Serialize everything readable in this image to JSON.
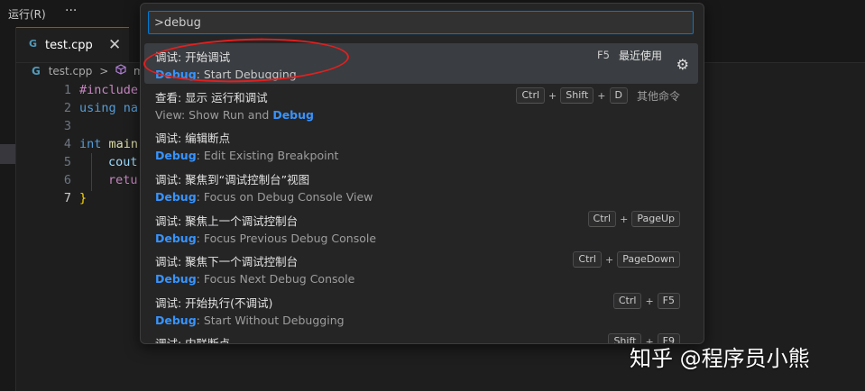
{
  "menubar": {
    "run_menu": "运行(R)",
    "more": "···"
  },
  "tab": {
    "label": "test.cpp",
    "icon": "C++",
    "close": "✕"
  },
  "breadcrumb": {
    "file": "test.cpp",
    "separator": ">",
    "symbol": "ma"
  },
  "editor": {
    "lines": [
      {
        "num": "1",
        "text": "#include"
      },
      {
        "num": "2",
        "text": "using na"
      },
      {
        "num": "3",
        "text": ""
      },
      {
        "num": "4",
        "text_kw": "int",
        "text_fn": "main"
      },
      {
        "num": "5",
        "text": "cout"
      },
      {
        "num": "6",
        "text": "retu"
      },
      {
        "num": "7",
        "text": "}"
      }
    ]
  },
  "palette": {
    "query": ">debug",
    "items": [
      {
        "title": "调试: 开始调试",
        "sub_hl": "Debug",
        "sub_rest": ": Start Debugging",
        "key1": "F5",
        "tag": "最近使用"
      },
      {
        "title": "查看: 显示 运行和调试",
        "sub_pre": "View: Show Run and ",
        "sub_hl": "Debug",
        "keys": [
          "Ctrl",
          "Shift",
          "D"
        ],
        "tag": "其他命令"
      },
      {
        "title": "调试: 编辑断点",
        "sub_hl": "Debug",
        "sub_rest": ": Edit Existing Breakpoint"
      },
      {
        "title": "调试: 聚焦到“调试控制台”视图",
        "sub_hl": "Debug",
        "sub_rest": ": Focus on Debug Console View"
      },
      {
        "title": "调试: 聚焦上一个调试控制台",
        "sub_hl": "Debug",
        "sub_rest": ": Focus Previous Debug Console",
        "keys": [
          "Ctrl",
          "PageUp"
        ]
      },
      {
        "title": "调试: 聚焦下一个调试控制台",
        "sub_hl": "Debug",
        "sub_rest": ": Focus Next Debug Console",
        "keys": [
          "Ctrl",
          "PageDown"
        ]
      },
      {
        "title": "调试: 开始执行(不调试)",
        "sub_hl": "Debug",
        "sub_rest": ": Start Without Debugging",
        "keys": [
          "Ctrl",
          "F5"
        ]
      },
      {
        "title": "调试: 内联断点",
        "keys": [
          "Shift",
          "F9"
        ]
      }
    ],
    "plus": "+"
  },
  "watermark": "知乎 @程序员小熊",
  "colors": {
    "accent": "#0078d4",
    "highlight": "#3794ff",
    "annotation": "#e02020"
  }
}
